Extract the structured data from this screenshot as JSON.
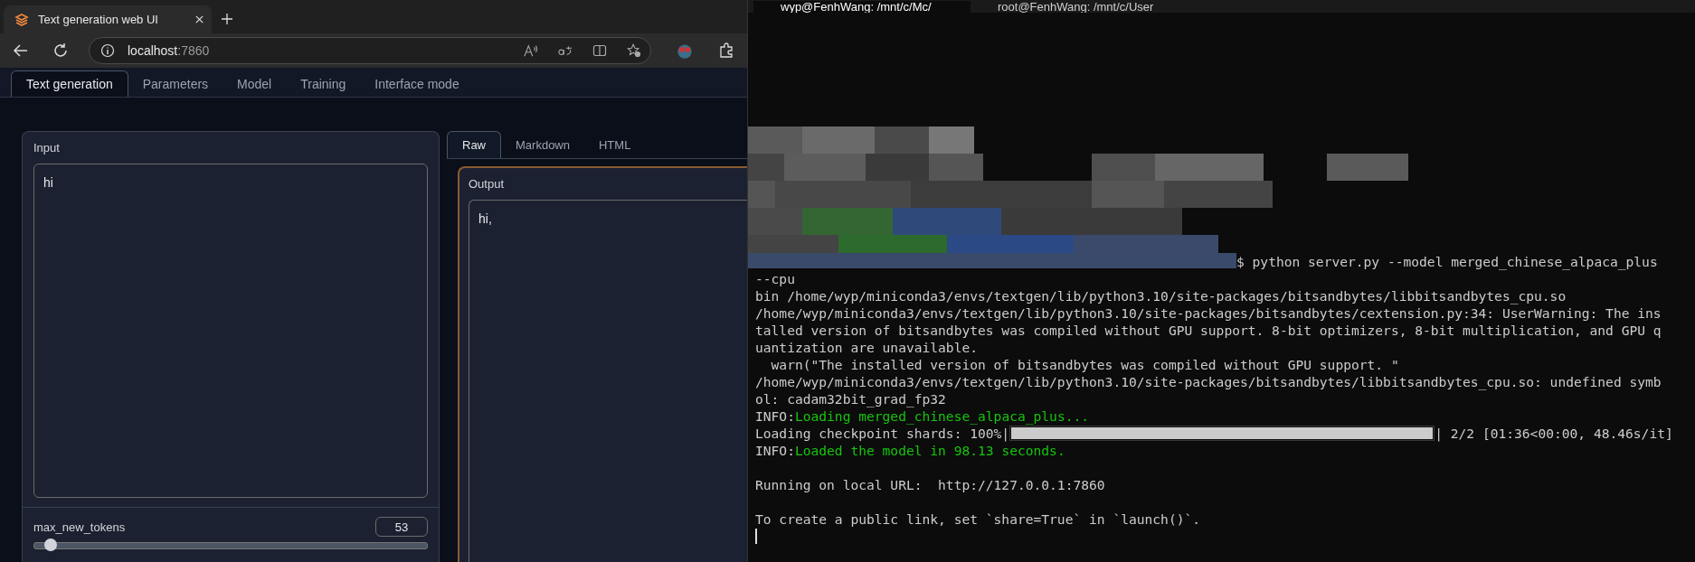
{
  "browser": {
    "tab": {
      "title": "Text generation web UI"
    },
    "address": {
      "host": "localhost",
      "port": ":7860"
    }
  },
  "app": {
    "tabs": [
      {
        "label": "Text generation",
        "selected": true
      },
      {
        "label": "Parameters",
        "selected": false
      },
      {
        "label": "Model",
        "selected": false
      },
      {
        "label": "Training",
        "selected": false
      },
      {
        "label": "Interface mode",
        "selected": false
      }
    ],
    "input": {
      "label": "Input",
      "value": "hi"
    },
    "max_new_tokens": {
      "label": "max_new_tokens",
      "value": "53",
      "level": 0.04
    },
    "output_tabs": [
      {
        "label": "Raw",
        "selected": true
      },
      {
        "label": "Markdown",
        "selected": false
      },
      {
        "label": "HTML",
        "selected": false
      }
    ],
    "output": {
      "label": "Output",
      "value": "hi,"
    }
  },
  "terminal": {
    "tabs": [
      {
        "title": "wyp@FenhWang: /mnt/c/Mc/",
        "selected": true
      },
      {
        "title": "root@FenhWang: /mnt/c/User",
        "selected": false
      }
    ],
    "lines": [
      {
        "kind": "prompt",
        "text": "$ python server.py --model merged_chinese_alpaca_plus"
      },
      {
        "kind": "text",
        "text": "--cpu"
      },
      {
        "kind": "text",
        "text": "bin /home/wyp/miniconda3/envs/textgen/lib/python3.10/site-packages/bitsandbytes/libbitsandbytes_cpu.so"
      },
      {
        "kind": "text",
        "text": "/home/wyp/miniconda3/envs/textgen/lib/python3.10/site-packages/bitsandbytes/cextension.py:34: UserWarning: The ins"
      },
      {
        "kind": "text",
        "text": "talled version of bitsandbytes was compiled without GPU support. 8-bit optimizers, 8-bit multiplication, and GPU q"
      },
      {
        "kind": "text",
        "text": "uantization are unavailable."
      },
      {
        "kind": "text",
        "text": "  warn(\"The installed version of bitsandbytes was compiled without GPU support. \""
      },
      {
        "kind": "text",
        "text": "/home/wyp/miniconda3/envs/textgen/lib/python3.10/site-packages/bitsandbytes/libbitsandbytes_cpu.so: undefined symb"
      },
      {
        "kind": "text",
        "text": "ol: cadam32bit_grad_fp32"
      },
      {
        "kind": "info",
        "prefix": "INFO:",
        "text": "Loading merged_chinese_alpaca_plus..."
      },
      {
        "kind": "progress",
        "label": "Loading checkpoint shards: 100%|",
        "level": 1,
        "reading": "| 2/2 [01:36<00:00, 48.46s/it]"
      },
      {
        "kind": "info",
        "prefix": "INFO:",
        "text": "Loaded the model in 98.13 seconds."
      },
      {
        "kind": "blank"
      },
      {
        "kind": "text",
        "text": "Running on local URL:  http://127.0.0.1:7860"
      },
      {
        "kind": "blank"
      },
      {
        "kind": "text",
        "text": "To create a public link, set `share=True` in `launch()`."
      },
      {
        "kind": "cursor"
      }
    ]
  }
}
